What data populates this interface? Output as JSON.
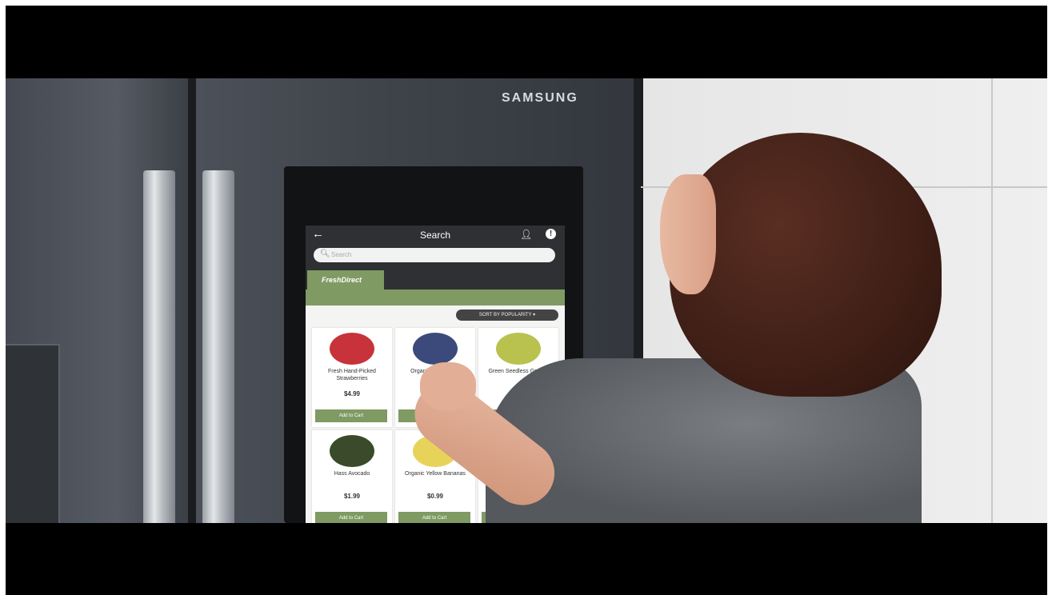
{
  "brand": {
    "logo_text": "SAMSUNG"
  },
  "screen": {
    "back_icon": "arrow-left-icon",
    "title": "Search",
    "user_icon": "user-icon",
    "info_icon": "info-icon",
    "search_placeholder": "Search",
    "store_tab": "FreshDirect",
    "breadcrumb": "",
    "results_text": "",
    "sort_label": "SORT BY POPULARITY ▾",
    "add_to_cart_label": "Add to Cart",
    "products": [
      {
        "name": "Fresh Hand-Picked Strawberries",
        "price": "$4.99",
        "color": "#c8323a"
      },
      {
        "name": "Organic Blueberries",
        "price": "",
        "color": "#3b4a7a"
      },
      {
        "name": "Green Seedless Grapes",
        "price": "$3.99",
        "color": "#b9c24e"
      },
      {
        "name": "Hass Avocado",
        "price": "$1.99",
        "color": "#3a4a2a"
      },
      {
        "name": "Organic Yellow Bananas",
        "price": "$0.99",
        "color": "#e8d35a"
      },
      {
        "name": "",
        "price": "",
        "color": "#f4f4f2"
      }
    ]
  },
  "colors": {
    "accent_green": "#7f9a63",
    "topbar_dark": "#2e3033"
  }
}
